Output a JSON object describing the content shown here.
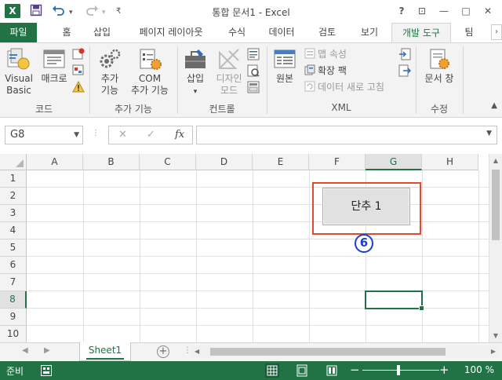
{
  "window": {
    "title": "통합 문서1 - Excel",
    "app_logo": "X",
    "help": "?",
    "restore": "⊡",
    "minimize": "—",
    "maximize": "□",
    "close": "✕"
  },
  "qat": {
    "save_icon": "save-icon",
    "undo_icon": "undo-icon",
    "redo_icon": "redo-icon",
    "customize_icon": "customize-icon"
  },
  "tabs": [
    "파일",
    "홈",
    "삽입",
    "페이지 레이아웃",
    "수식",
    "데이터",
    "검토",
    "보기",
    "개발 도구",
    "팀"
  ],
  "active_tab": "개발 도구",
  "ribbon": {
    "code_group": {
      "label": "코드",
      "visual_basic": "Visual\nBasic",
      "vb_line1": "Visual",
      "vb_line2": "Basic",
      "macro": "매크로"
    },
    "addins_group": {
      "label": "추가 기능",
      "addins_line1": "추가",
      "addins_line2": "기능",
      "com_line1": "COM",
      "com_line2": "추가 기능"
    },
    "controls_group": {
      "label": "컨트롤",
      "insert": "삽입",
      "design_line1": "디자인",
      "design_line2": "모드"
    },
    "xml_group": {
      "label": "XML",
      "source": "원본",
      "map_properties": "맵 속성",
      "expansion_packs": "확장 팩",
      "refresh_data": "데이터 새로 고침"
    },
    "modify_group": {
      "label": "수정",
      "document_panel": "문서 창"
    }
  },
  "formula_bar": {
    "name_box": "G8",
    "fx": "fx",
    "cancel": "✕",
    "enter": "✓",
    "formula": ""
  },
  "grid": {
    "columns": [
      "A",
      "B",
      "C",
      "D",
      "E",
      "F",
      "G",
      "H"
    ],
    "rows": [
      "1",
      "2",
      "3",
      "4",
      "5",
      "6",
      "7",
      "8",
      "9",
      "10"
    ],
    "selected_cell": "G8",
    "selected_column": "G",
    "selected_row": "8"
  },
  "form_control": {
    "button_label": "단추 1",
    "callout_number": "6",
    "highlight_color": "#e04b2f",
    "callout_color": "#1a3fd0"
  },
  "sheets": {
    "tabs": [
      "Sheet1"
    ],
    "active": "Sheet1",
    "add": "+"
  },
  "status": {
    "ready": "준비",
    "zoom_minus": "−",
    "zoom_plus": "+",
    "zoom": "100 %"
  },
  "colors": {
    "accent": "#217346",
    "ribbon_bg": "#f3f3f3"
  }
}
